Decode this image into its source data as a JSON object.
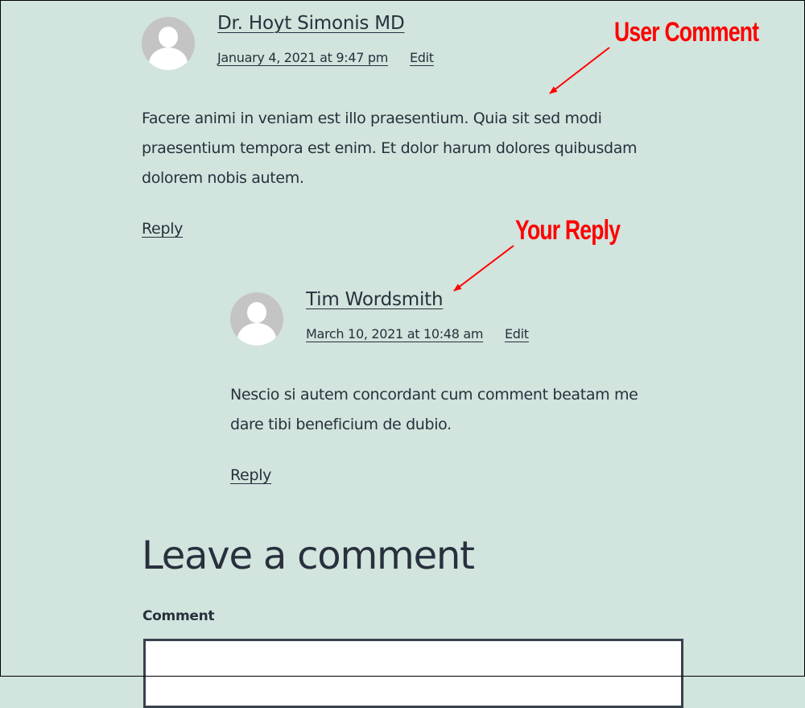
{
  "comments": [
    {
      "author": "Dr. Hoyt Simonis MD",
      "timestamp": "January 4, 2021 at 9:47 pm",
      "edit_label": "Edit",
      "content": "Facere animi in veniam est illo praesentium. Quia sit sed modi praesentium tempora est enim. Et dolor harum dolores quibusdam dolorem nobis autem.",
      "reply_label": "Reply",
      "avatar_icon": "default-avatar-icon"
    },
    {
      "author": "Tim Wordsmith",
      "timestamp": "March 10, 2021 at 10:48 am",
      "edit_label": "Edit",
      "content": "Nescio si autem concordant cum comment beatam me dare tibi beneficium de dubio.",
      "reply_label": "Reply",
      "avatar_icon": "default-avatar-icon",
      "is_reply": true
    }
  ],
  "annotations": {
    "user_comment": "User Comment",
    "your_reply": "Your Reply",
    "color": "#ff0000"
  },
  "comment_form": {
    "heading": "Leave a comment",
    "comment_label": "Comment",
    "comment_value": ""
  },
  "colors": {
    "background": "#d1e4dd",
    "text": "#28303d",
    "avatar": "#c4c4c4"
  }
}
